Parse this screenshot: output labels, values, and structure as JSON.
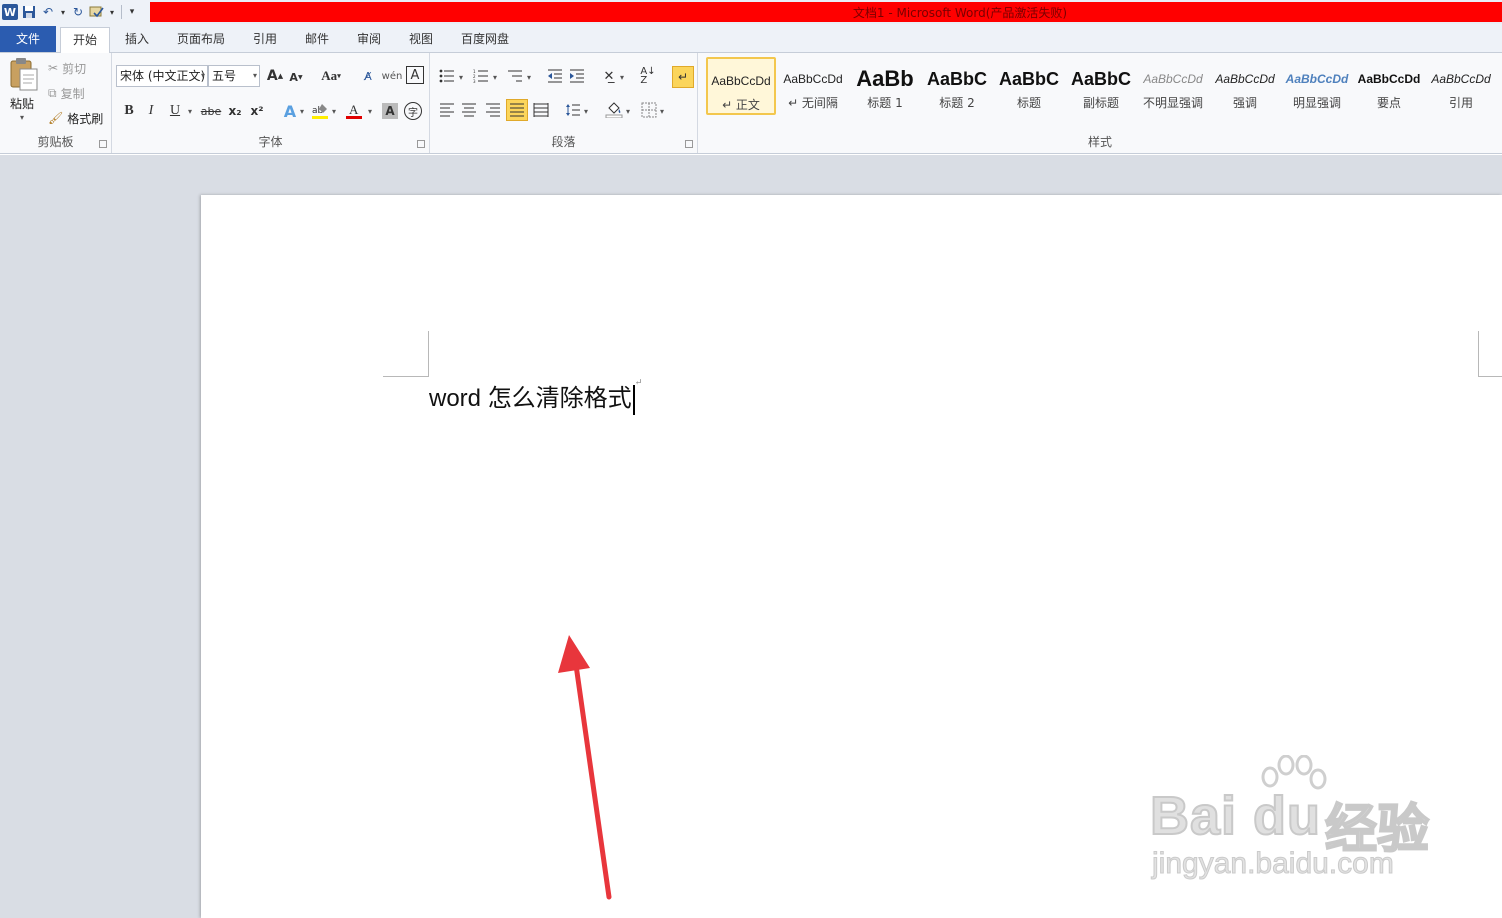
{
  "window": {
    "title": "文档1 - Microsoft Word(产品激活失败)"
  },
  "qat": {
    "icons": [
      "word-icon",
      "save-icon",
      "undo-icon",
      "redo-icon",
      "spellcheck-icon",
      "customize-icon"
    ]
  },
  "tabs": {
    "file": "文件",
    "home": "开始",
    "insert": "插入",
    "layout": "页面布局",
    "references": "引用",
    "mailings": "邮件",
    "review": "审阅",
    "view": "视图",
    "baidu": "百度网盘"
  },
  "clipboard": {
    "paste": "粘贴",
    "cut": "剪切",
    "copy": "复制",
    "format_painter": "格式刷",
    "label": "剪贴板"
  },
  "font": {
    "name": "宋体 (中文正文)",
    "size": "五号",
    "grow": "A",
    "shrink": "A",
    "case": "Aa",
    "bold": "B",
    "italic": "I",
    "underline": "U",
    "strike": "abe",
    "sub": "x₂",
    "sup": "x²",
    "label": "字体"
  },
  "paragraph": {
    "label": "段落"
  },
  "styles": {
    "label": "样式",
    "items": [
      {
        "preview": "AaBbCcDd",
        "name": "↵ 正文",
        "selected": true
      },
      {
        "preview": "AaBbCcDd",
        "name": "↵ 无间隔",
        "selected": false
      },
      {
        "preview": "AaBb",
        "name": "标题 1",
        "selected": false
      },
      {
        "preview": "AaBbC",
        "name": "标题 2",
        "selected": false
      },
      {
        "preview": "AaBbC",
        "name": "标题",
        "selected": false
      },
      {
        "preview": "AaBbC",
        "name": "副标题",
        "selected": false
      },
      {
        "preview": "AaBbCcDd",
        "name": "不明显强调",
        "selected": false
      },
      {
        "preview": "AaBbCcDd",
        "name": "强调",
        "selected": false
      },
      {
        "preview": "AaBbCcDd",
        "name": "明显强调",
        "selected": false
      },
      {
        "preview": "AaBbCcDd",
        "name": "要点",
        "selected": false
      },
      {
        "preview": "AaBbCcDd",
        "name": "引用",
        "selected": false
      }
    ]
  },
  "document": {
    "latin": "word ",
    "chinese": "怎么清除格式",
    "para_mark": "↵"
  },
  "watermark": {
    "logo": "Bai du",
    "cn": "经验",
    "url": "jingyan.baidu.com"
  },
  "colors": {
    "title_red": "#ff0000",
    "file_tab": "#2b5cb0",
    "arrow": "#e8363c",
    "style_selected": "#f3c74d"
  }
}
